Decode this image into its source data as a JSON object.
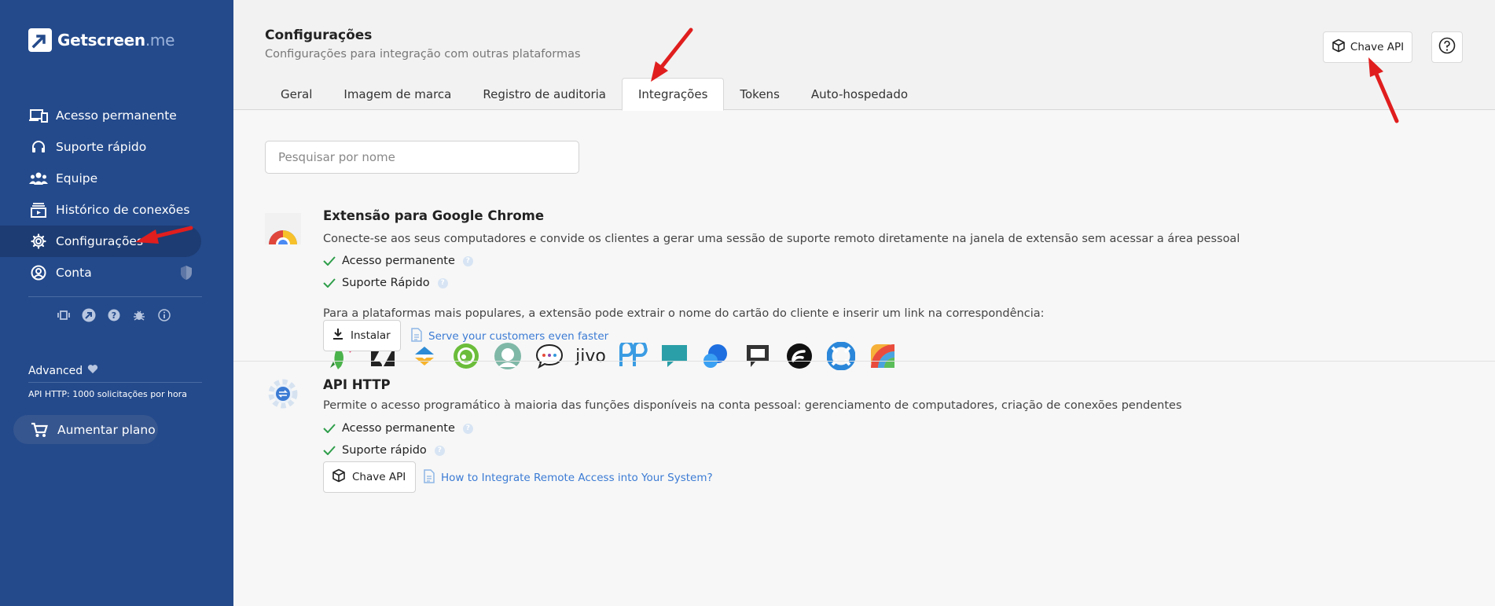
{
  "brand": {
    "name": "Getscreen",
    "suffix": ".me"
  },
  "sidebar": {
    "items": [
      {
        "label": "Acesso permanente",
        "icon": "devices-icon"
      },
      {
        "label": "Suporte rápido",
        "icon": "support-headset-icon"
      },
      {
        "label": "Equipe",
        "icon": "team-icon"
      },
      {
        "label": "Histórico de conexões",
        "icon": "history-icon"
      },
      {
        "label": "Configurações",
        "icon": "gear-icon",
        "active": true
      },
      {
        "label": "Conta",
        "icon": "account-icon"
      }
    ],
    "mini_icons": [
      "remote-icon",
      "logo-icon",
      "help-icon",
      "bug-icon",
      "info-icon"
    ],
    "plan_name": "Advanced",
    "api_limit": "API HTTP: 1000 solicitações por hora",
    "upgrade_label": "Aumentar plano"
  },
  "header": {
    "title": "Configurações",
    "subtitle": "Configurações para integração com outras plataformas",
    "api_key_button": "Chave API",
    "tabs": [
      {
        "label": "Geral"
      },
      {
        "label": "Imagem de marca"
      },
      {
        "label": "Registro de auditoria"
      },
      {
        "label": "Integrações",
        "active": true
      },
      {
        "label": "Tokens"
      },
      {
        "label": "Auto-hospedado"
      }
    ]
  },
  "search": {
    "placeholder": "Pesquisar por nome"
  },
  "chrome_extension": {
    "title": "Extensão para Google Chrome",
    "description": "Conecte-se aos seus computadores e convide os clientes a gerar uma sessão de suporte remoto diretamente na janela de extensão sem acessar a área pessoal",
    "features": [
      "Acesso permanente",
      "Suporte Rápido"
    ],
    "platforms_text": "Para a plataformas mais populares, a extensão pode extrair o nome do cartão do cliente e inserir um link na correspondência:",
    "platforms": [
      "parrot-icon",
      "zendesk-icon",
      "freshdesk-icon",
      "green-circle-icon",
      "user-circle-icon",
      "chat-bubble-icon",
      "jivo-icon",
      "pp-icon",
      "chat-teal-icon",
      "chat-blue-icon",
      "chat-dark-icon",
      "front-icon",
      "lifesaver-icon",
      "rainbow-icon"
    ],
    "jivo_text": "jivo",
    "install_button": "Instalar",
    "link": "Serve your customers even faster"
  },
  "http_api": {
    "title": "API HTTP",
    "description": "Permite o acesso programático à maioria das funções disponíveis na conta pessoal: gerenciamento de computadores, criação de conexões pendentes",
    "features": [
      "Acesso permanente",
      "Suporte rápido"
    ],
    "api_key_button": "Chave API",
    "link": "How to Integrate Remote Access into Your System?"
  },
  "colors": {
    "sidebar": "#244a8b",
    "accent": "#3b7bd4",
    "check": "#2e9e4a",
    "arrow": "#e01e1e"
  }
}
